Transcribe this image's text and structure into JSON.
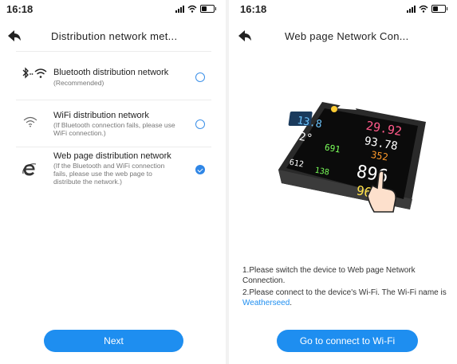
{
  "left": {
    "status": {
      "time": "16:18"
    },
    "nav": {
      "title": "Distribution network met..."
    },
    "options": [
      {
        "icon": "bluetooth-wifi-icon",
        "title": "Bluetooth distribution network",
        "subtitle": "(Recommended)",
        "selected": false
      },
      {
        "icon": "wifi-icon",
        "title": "WiFi distribution network",
        "subtitle": "(If Bluetooth connection fails, please use WiFi connection.)",
        "selected": false
      },
      {
        "icon": "browser-e-icon",
        "title": "Web page distribution network",
        "subtitle": "(If the Bluetooth and WiFi connection fails, please use the web page to distribute the network.)",
        "selected": true
      }
    ],
    "next_label": "Next"
  },
  "right": {
    "status": {
      "time": "16:18"
    },
    "nav": {
      "title": "Web page Network Con..."
    },
    "instructions": {
      "line1": "1.Please switch the device to Web page Network Connection.",
      "line2_prefix": "2.Please connect to the device's Wi-Fi. The Wi-Fi name is ",
      "wifi_name": "Weatherseed",
      "line2_suffix": "."
    },
    "device_readings": {
      "r1": "13.8",
      "r2": "29.92",
      "r3": "22°",
      "r4": "93.78",
      "r5": "691",
      "r6": "352",
      "r7": "896",
      "r8": "96",
      "r9": "612",
      "r10": "138"
    },
    "connect_label": "Go to connect to Wi-Fi"
  },
  "colors": {
    "accent": "#1e8ef0"
  }
}
